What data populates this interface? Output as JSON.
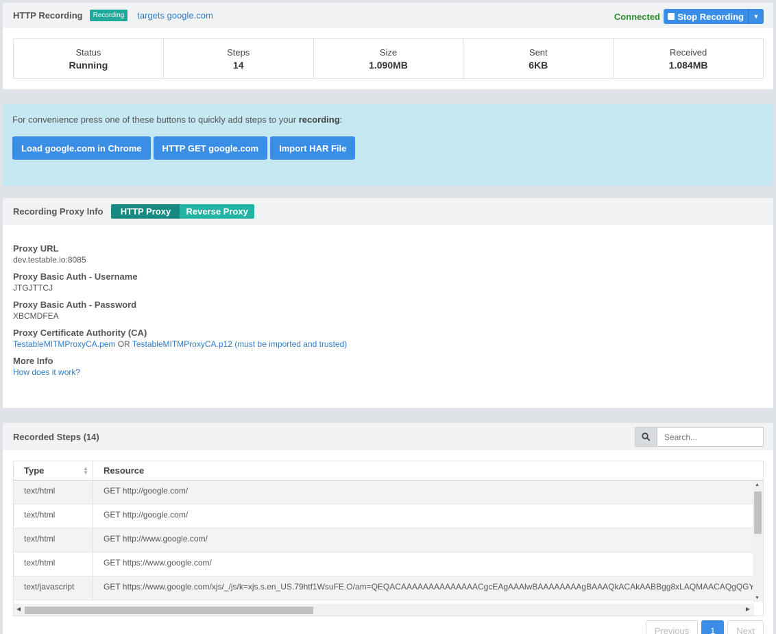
{
  "header": {
    "title": "HTTP Recording",
    "badge": "Recording",
    "targets_link": "targets google.com",
    "connection_status": "Connected",
    "stop_button": "Stop Recording"
  },
  "stats": [
    {
      "label": "Status",
      "value": "Running"
    },
    {
      "label": "Steps",
      "value": "14"
    },
    {
      "label": "Size",
      "value": "1.090MB"
    },
    {
      "label": "Sent",
      "value": "6KB"
    },
    {
      "label": "Received",
      "value": "1.084MB"
    }
  ],
  "quick_add": {
    "text_before": "For convenience press one of these buttons to quickly add steps to your ",
    "text_bold": "recording",
    "text_after": ":",
    "buttons": [
      "Load google.com in Chrome",
      "HTTP GET google.com",
      "Import HAR File"
    ]
  },
  "proxy_info": {
    "title": "Recording Proxy Info",
    "toggle_active": "HTTP Proxy",
    "toggle_inactive": "Reverse Proxy",
    "url_label": "Proxy URL",
    "url_value": "dev.testable.io:8085",
    "username_label": "Proxy Basic Auth - Username",
    "username_value": "JTGJTTCJ",
    "password_label": "Proxy Basic Auth - Password",
    "password_value": "XBCMDFEA",
    "ca_label": "Proxy Certificate Authority (CA)",
    "ca_pem_link": "TestableMITMProxyCA.pem",
    "ca_or": " OR ",
    "ca_p12_link": "TestableMITMProxyCA.p12 (must be imported and trusted)",
    "more_label": "More Info",
    "more_link": "How does it work?"
  },
  "recorded_steps": {
    "title": "Recorded Steps (14)",
    "search_placeholder": "Search...",
    "columns": [
      "Type",
      "Resource"
    ],
    "rows": [
      {
        "type": "text/html",
        "resource": "GET http://google.com/"
      },
      {
        "type": "text/html",
        "resource": "GET http://google.com/"
      },
      {
        "type": "text/html",
        "resource": "GET http://www.google.com/"
      },
      {
        "type": "text/html",
        "resource": "GET https://www.google.com/"
      },
      {
        "type": "text/javascript",
        "resource": "GET https://www.google.com/xjs/_/js/k=xjs.s.en_US.79htf1WsuFE.O/am=QEQACAAAAAAAAAAAAAACgcEAgAAAlwBAAAAAAAAgBAAAQkACAkAABBgg8xLAQMAACAQgQGY"
      }
    ],
    "pagination": {
      "previous": "Previous",
      "page": "1",
      "next": "Next"
    }
  }
}
